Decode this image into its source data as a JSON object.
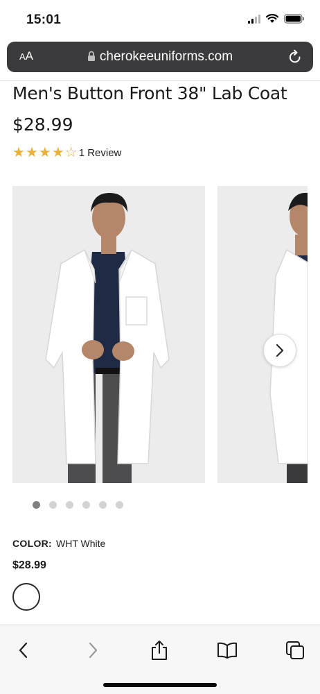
{
  "status_bar": {
    "time": "15:01"
  },
  "address_bar": {
    "text_size_label_small": "A",
    "text_size_label_large": "A",
    "url": "cherokeeuniforms.com"
  },
  "product": {
    "title": "Men's Button Front 38\" Lab Coat",
    "price": "$28.99",
    "rating": {
      "value": 4,
      "max": 5
    },
    "review_link": "1 Review"
  },
  "carousel": {
    "image_count": 6,
    "active_index": 0
  },
  "color": {
    "label": "COLOR:",
    "value": "WHT White"
  },
  "variant_price": "$28.99",
  "toolbar": {
    "icons": [
      "back-icon",
      "forward-icon",
      "share-icon",
      "bookmarks-icon",
      "tabs-icon"
    ]
  },
  "colors": {
    "star": "#e8b23a",
    "address_bar_bg": "#3b3b3d",
    "dot_active": "#808080",
    "dot_inactive": "#d3d3d3"
  }
}
